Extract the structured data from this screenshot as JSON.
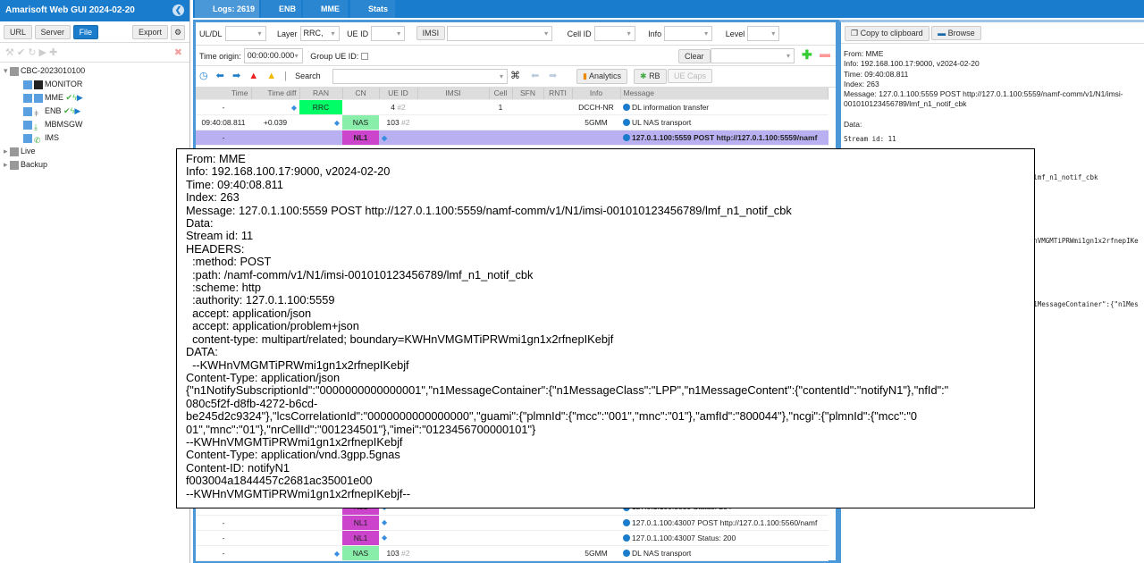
{
  "app": {
    "title": "Amarisoft Web GUI 2024-02-20"
  },
  "left": {
    "buttons": [
      "URL",
      "Server",
      "File",
      "Export"
    ],
    "tree": [
      {
        "label": "CBC-2023010100",
        "icon": "folder-icon"
      },
      {
        "label": "MONITOR",
        "icon": "terminal-icon"
      },
      {
        "label": "MME",
        "icon": "database-icon"
      },
      {
        "label": "ENB",
        "icon": "antenna-icon"
      },
      {
        "label": "MBMSGW",
        "icon": "download-icon"
      },
      {
        "label": "IMS",
        "icon": "phone-icon"
      },
      {
        "label": "Live",
        "icon": "folder-icon"
      },
      {
        "label": "Backup",
        "icon": "folder-icon"
      }
    ]
  },
  "tabs": [
    {
      "label": "Logs: 2619",
      "icon": "document-icon"
    },
    {
      "label": "ENB",
      "icon": "antenna-icon"
    },
    {
      "label": "MME",
      "icon": "database-icon"
    },
    {
      "label": "Stats",
      "icon": "chart-icon"
    }
  ],
  "filters": {
    "uldl": "UL/DL",
    "layer": "Layer",
    "layer_value": "RRC,",
    "ueid": "UE ID",
    "imsi": "IMSI",
    "cellid": "Cell ID",
    "info": "Info",
    "level": "Level",
    "time_origin": "Time origin:",
    "time_origin_value": "00:00:00.000",
    "group_ue": "Group UE ID:",
    "clear": "Clear",
    "search": "Search",
    "analytics": "Analytics",
    "rb": "RB",
    "uecaps": "UE Caps"
  },
  "table": {
    "headers": [
      "Time",
      "Time diff",
      "RAN",
      "CN",
      "UE ID",
      "IMSI",
      "Cell",
      "SFN",
      "RNTI",
      "Info",
      "Message"
    ],
    "rows": [
      {
        "time": "-",
        "diff": "",
        "ran": "RRC",
        "cn": "",
        "ueid": "4",
        "ueid2": "#2",
        "cell": "1",
        "info": "DCCH-NR",
        "msg": "DL information transfer"
      },
      {
        "time": "09:40:08.811",
        "diff": "+0.039",
        "ran": "",
        "cn": "NAS",
        "ueid": "103",
        "ueid2": "#2",
        "cell": "",
        "info": "5GMM",
        "msg": "UL NAS transport"
      },
      {
        "time": "-",
        "diff": "",
        "ran": "",
        "cn": "NL1",
        "ueid": "",
        "ueid2": "",
        "cell": "",
        "info": "",
        "msg": "127.0.1.100:5559 POST http://127.0.1.100:5559/namf"
      }
    ],
    "rows_bottom": [
      {
        "time": "-",
        "cn": "NL1",
        "ueid": "",
        "ueid2": "",
        "info": "",
        "msg": "127.0.1.100:5559 Status: 204"
      },
      {
        "time": "-",
        "cn": "NL1",
        "ueid": "",
        "ueid2": "",
        "info": "",
        "msg": "127.0.1.100:43007 POST http://127.0.1.100:5560/namf"
      },
      {
        "time": "-",
        "cn": "NL1",
        "ueid": "",
        "ueid2": "",
        "info": "",
        "msg": "127.0.1.100:43007 Status: 200"
      },
      {
        "time": "-",
        "cn": "NAS",
        "ueid": "103",
        "ueid2": "#2",
        "info": "5GMM",
        "msg": "DL NAS transport"
      }
    ]
  },
  "right": {
    "copy": "Copy to clipboard",
    "browse": "Browse",
    "lines": [
      "From: MME",
      "Info: 192.168.100.17:9000, v2024-02-20",
      "Time: 09:40:08.811",
      "Index: 263",
      "Message: 127.0.1.100:5559 POST http://127.0.1.100:5559/namf-comm/v1/N1/imsi-",
      "001010123456789/lmf_n1_notif_cbk",
      "",
      "Data:"
    ],
    "mono": [
      "Stream id: 11",
      "HEADERS:",
      "  :method: POST",
      "  :path: /namf-comm/v1/N1/imsi-001010123456789/lmf_n1_notif_cbk",
      "  :scheme: http",
      "  :authority: 127.0.1.100:5559",
      "  accept: application/json",
      "  accept: application/problem+json",
      "  content-type: multipart/related; boundary=KWHnVMGMTiPRWmi1gn1x2rfnepIKebjf",
      "DATA:",
      "  --KWHnVMGMTiPRWmi1gn1x2rfnepIKebjf",
      "Content-Type: application/json",
      "{\"n1NotifySubscriptionId\":\"0000000000000001\",\"n1MessageContainer\":{\"n1MessageClass\":\"LPP\""
    ]
  },
  "tooltip": "From: MME\nInfo: 192.168.100.17:9000, v2024-02-20\nTime: 09:40:08.811\nIndex: 263\nMessage: 127.0.1.100:5559 POST http://127.0.1.100:5559/namf-comm/v1/N1/imsi-001010123456789/lmf_n1_notif_cbk\nData:\nStream id: 11\nHEADERS:\n  :method: POST\n  :path: /namf-comm/v1/N1/imsi-001010123456789/lmf_n1_notif_cbk\n  :scheme: http\n  :authority: 127.0.1.100:5559\n  accept: application/json\n  accept: application/problem+json\n  content-type: multipart/related; boundary=KWHnVMGMTiPRWmi1gn1x2rfnepIKebjf\nDATA:\n  --KWHnVMGMTiPRWmi1gn1x2rfnepIKebjf\nContent-Type: application/json\n{\"n1NotifySubscriptionId\":\"0000000000000001\",\"n1MessageContainer\":{\"n1MessageClass\":\"LPP\",\"n1MessageContent\":{\"contentId\":\"notifyN1\"},\"nfId\":\"\n080c5f2f-d8fb-4272-b6cd-\nbe245d2c9324\"},\"lcsCorrelationId\":\"0000000000000000\",\"guami\":{\"plmnId\":{\"mcc\":\"001\",\"mnc\":\"01\"},\"amfId\":\"800044\"},\"ncgi\":{\"plmnId\":{\"mcc\":\"0\n01\",\"mnc\":\"01\"},\"nrCellId\":\"001234501\"},\"imei\":\"0123456700000101\"}\n--KWHnVMGMTiPRWmi1gn1x2rfnepIKebjf\nContent-Type: application/vnd.3gpp.5gnas\nContent-ID: notifyN1\nf003004a1844457c2681ac35001e00\n--KWHnVMGMTiPRWmi1gn1x2rfnepIKebjf--"
}
